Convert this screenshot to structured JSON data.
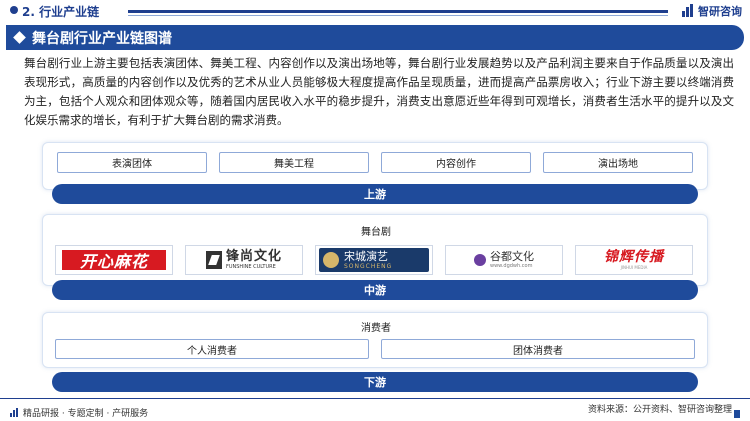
{
  "header": {
    "section_title": "2. 行业产业链",
    "brand_name": "智研咨询"
  },
  "title": "舞台剧行业产业链图谱",
  "paragraph": "舞台剧行业上游主要包括表演团体、舞美工程、内容创作以及演出场地等，舞台剧行业发展趋势以及产品利润主要来自于作品质量以及演出表现形式，高质量的内容创作以及优秀的艺术从业人员能够极大程度提高作品呈现质量，进而提高产品票房收入；行业下游主要以终端消费为主，包括个人观众和团体观众等，随着国内居民收入水平的稳步提升，消费支出意愿近些年得到可观增长，消费者生活水平的提升以及文化娱乐需求的增长，有利于扩大舞台剧的需求消费。",
  "upstream": {
    "items": [
      "表演团体",
      "舞美工程",
      "内容创作",
      "演出场地"
    ],
    "band_label": "上游"
  },
  "midstream": {
    "label": "舞台剧",
    "logos": {
      "kxmh": "开心麻花",
      "fs_cn": "锋尚文化",
      "fs_en": "FUNSHINE CULTURE",
      "sc_cn": "宋城演艺",
      "sc_en": "SONGCHENG",
      "gd_cn": "谷都文化",
      "gd_en": "www.dgdwh.com",
      "jh_cn": "锦辉传播",
      "jh_en": "JINHUI MEDIA"
    },
    "band_label": "中游"
  },
  "downstream": {
    "label": "消费者",
    "items": [
      "个人消费者",
      "团体消费者"
    ],
    "band_label": "下游"
  },
  "footer": {
    "left": "精品研报 · 专题定制 · 产研服务",
    "source": "资料来源：公开资料、智研咨询整理"
  }
}
